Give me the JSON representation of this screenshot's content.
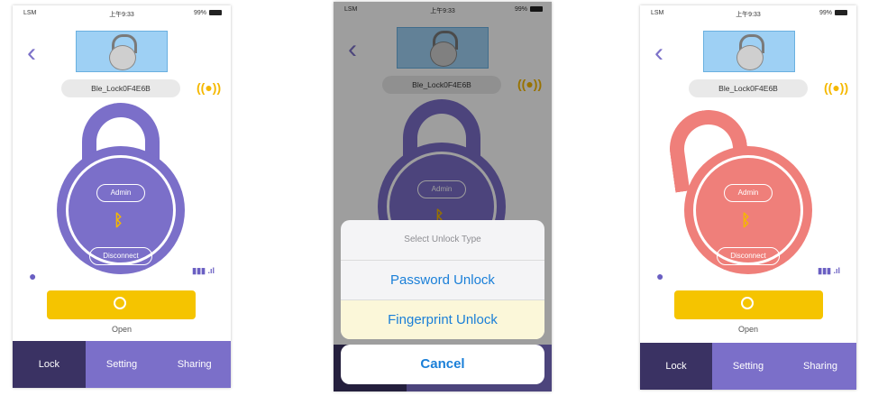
{
  "status_bar": {
    "carrier": "LSM",
    "time": "上午9:33",
    "battery": "99%"
  },
  "device_name": "Ble_Lock0F4E6B",
  "lock_labels": {
    "admin": "Admin",
    "disconnect": "Disconnect"
  },
  "open_label": "Open",
  "tabs": [
    {
      "label": "Lock",
      "active": true
    },
    {
      "label": "Setting",
      "active": false
    },
    {
      "label": "Sharing",
      "active": false
    }
  ],
  "signal_indicator": "((●))",
  "battery_signal": "▮▮▮ .ıl",
  "unlock_dialog": {
    "title": "Select Unlock Type",
    "options": [
      "Password Unlock",
      "Fingerprint Unlock"
    ],
    "cancel": "Cancel"
  },
  "colors": {
    "accent": "#7b6fc9",
    "unlocked": "#ef7f7a",
    "open_button": "#f5c400",
    "ios_blue": "#1a7fd8"
  },
  "icons": [
    "back-chevron-icon",
    "padlock-image-icon",
    "signal-wave-icon",
    "bluetooth-icon",
    "chat-icon",
    "battery-icon",
    "cellular-signal-icon",
    "open-circle-icon"
  ]
}
